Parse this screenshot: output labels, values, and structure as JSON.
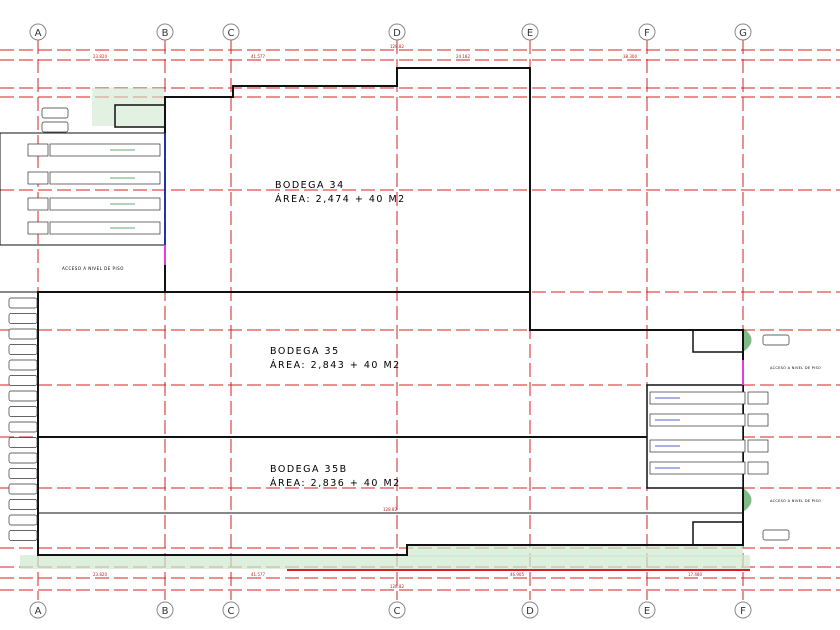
{
  "grid_top": [
    "A",
    "B",
    "C",
    "D",
    "E",
    "F",
    "G"
  ],
  "grid_bottom": [
    "A",
    "B",
    "C",
    "C",
    "D",
    "E",
    "F"
  ],
  "dims_top": [
    "23.820",
    "41.577",
    "24.182",
    "38.300"
  ],
  "dim_total_top": "128.82",
  "dims_bottom": [
    "23.820",
    "41.577",
    "46.905",
    "17.480"
  ],
  "dim_total_bottom": "128.82",
  "dim_inner": "128.82",
  "rooms": [
    {
      "name": "BODEGA 34",
      "area": "ÁREA: 2,474 + 40  M2"
    },
    {
      "name": "BODEGA 35",
      "area": "ÁREA: 2,843 + 40  M2"
    },
    {
      "name": "BODEGA 35B",
      "area": "ÁREA: 2,836 + 40  M2"
    }
  ],
  "access_label": "ACCESO A NIVEL DE PISO",
  "colors": {
    "grid": "#d42020",
    "wall": "#111111",
    "green": "#2e8b3a",
    "magenta": "#e040e0",
    "blue": "#2233aa"
  }
}
